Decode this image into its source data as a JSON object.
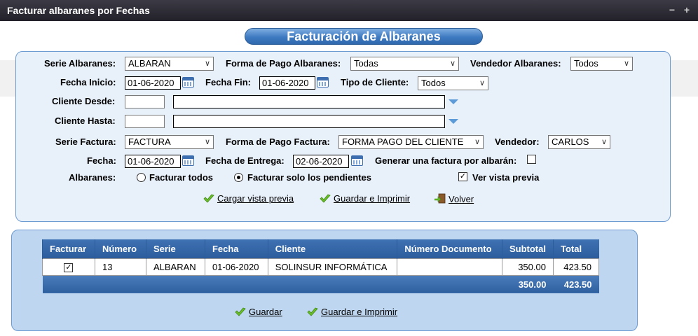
{
  "window": {
    "title": "Facturar albaranes por Fechas",
    "minimize": "−",
    "maximize": "+"
  },
  "heading": "Facturación de Albaranes",
  "form": {
    "serie_albaranes": {
      "label": "Serie Albaranes:",
      "value": "ALBARAN"
    },
    "forma_pago_albaranes": {
      "label": "Forma de Pago Albaranes:",
      "value": "Todas"
    },
    "vendedor_albaranes": {
      "label": "Vendedor Albaranes:",
      "value": "Todos"
    },
    "fecha_inicio": {
      "label": "Fecha Inicio:",
      "value": "01-06-2020"
    },
    "fecha_fin": {
      "label": "Fecha Fin:",
      "value": "01-06-2020"
    },
    "tipo_cliente": {
      "label": "Tipo de Cliente:",
      "value": "Todos"
    },
    "cliente_desde": {
      "label": "Cliente Desde:",
      "code": "",
      "name": ""
    },
    "cliente_hasta": {
      "label": "Cliente Hasta:",
      "code": "",
      "name": ""
    },
    "serie_factura": {
      "label": "Serie Factura:",
      "value": "FACTURA"
    },
    "forma_pago_factura": {
      "label": "Forma de Pago Factura:",
      "value": "FORMA PAGO DEL CLIENTE"
    },
    "vendedor": {
      "label": "Vendedor:",
      "value": "CARLOS"
    },
    "fecha": {
      "label": "Fecha:",
      "value": "01-06-2020"
    },
    "fecha_entrega": {
      "label": "Fecha de Entrega:",
      "value": "02-06-2020"
    },
    "una_factura_por_albaran": {
      "label": "Generar una factura por albarán:",
      "checked": false
    },
    "albaranes": {
      "label": "Albaranes:",
      "options": [
        "Facturar todos",
        "Facturar solo los pendientes"
      ],
      "selected": "Facturar solo los pendientes"
    },
    "ver_vista_previa": {
      "label": "Ver vista previa",
      "checked": true
    }
  },
  "actions": {
    "cargar": "Cargar vista previa",
    "guardar_imprimir": "Guardar e Imprimir",
    "volver": "Volver"
  },
  "table": {
    "headers": [
      "Facturar",
      "Número",
      "Serie",
      "Fecha",
      "Cliente",
      "Número Documento",
      "Subtotal",
      "Total"
    ],
    "rows": [
      {
        "facturar": true,
        "numero": "13",
        "serie": "ALBARAN",
        "fecha": "01-06-2020",
        "cliente": "SOLINSUR INFORMÁTICA",
        "documento": "",
        "subtotal": "350.00",
        "total": "423.50"
      }
    ],
    "totals": {
      "subtotal": "350.00",
      "total": "423.50"
    }
  },
  "bottom_actions": {
    "guardar": "Guardar",
    "guardar_imprimir": "Guardar e Imprimir"
  },
  "colors": {
    "accent": "#3e7ac1",
    "panel_border": "#6c9bd2",
    "check_green": "#6cbf2a"
  }
}
